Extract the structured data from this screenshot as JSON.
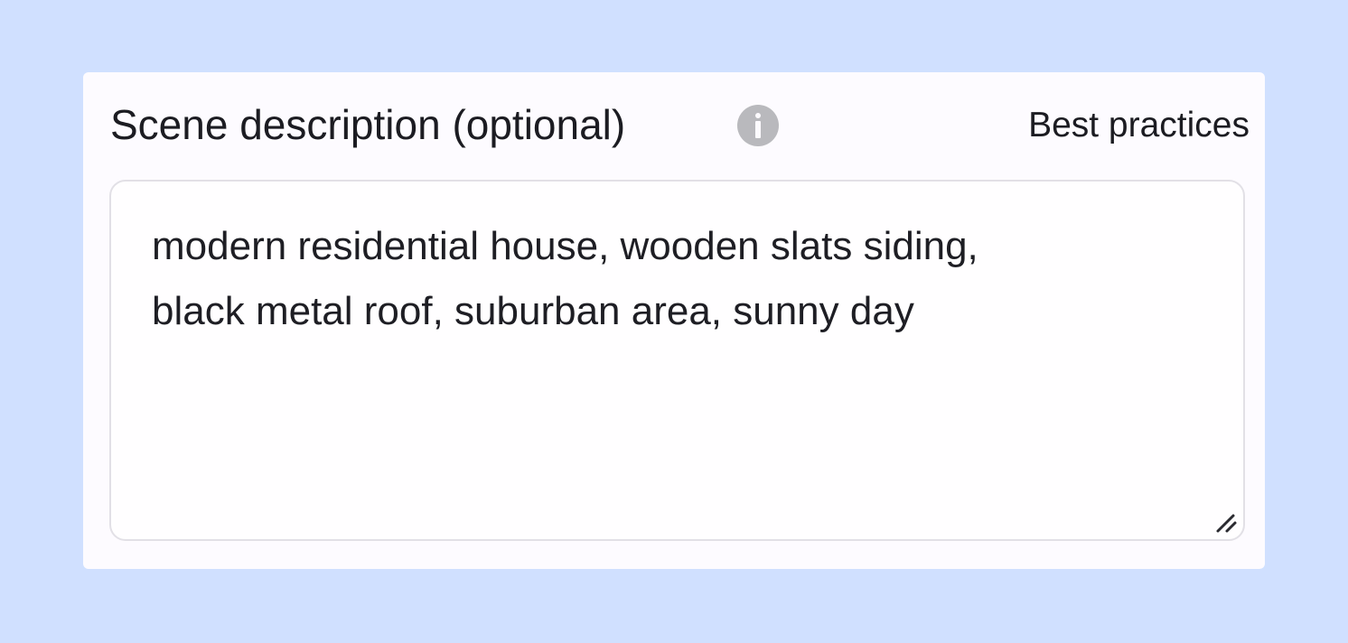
{
  "field": {
    "label": "Scene description (optional)",
    "info_icon": "info-icon",
    "help_link": "Best practices",
    "value": "modern residential house, wooden slats siding,\nblack metal roof, suburban area, sunny day",
    "resize_icon": "resize-handle-icon"
  },
  "colors": {
    "background": "#d0e0ff",
    "card": "#fdfbff",
    "text": "#1c1c22",
    "icon": "#b9b9bd",
    "border": "#e2e0e6"
  }
}
